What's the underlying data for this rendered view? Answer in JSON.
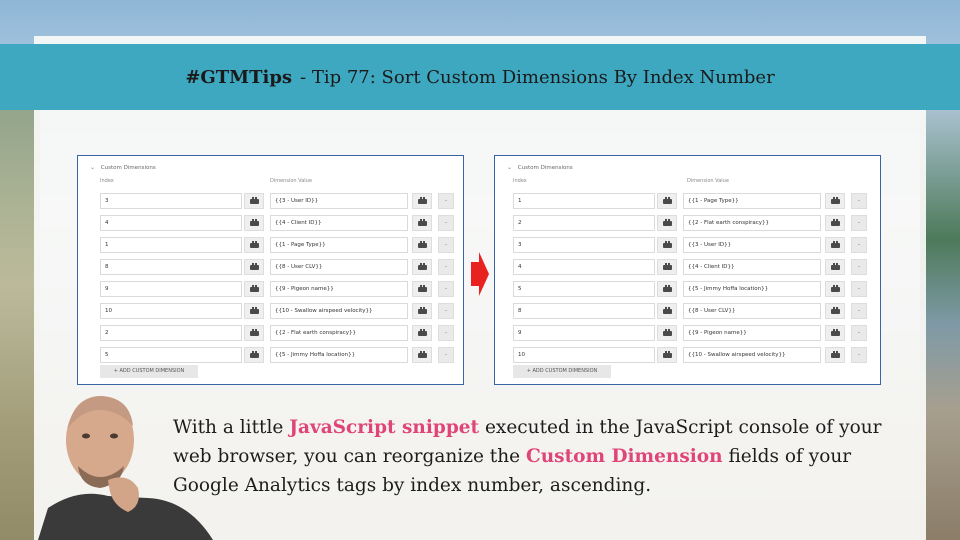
{
  "header": {
    "hashtag": "#GTMTips",
    "title": "- Tip 77: Sort Custom Dimensions By Index Number"
  },
  "before": {
    "section_title": "Custom Dimensions",
    "col_index": "Index",
    "col_value": "Dimension Value",
    "rows": [
      {
        "index": "3",
        "value": "{{3 - User ID}}"
      },
      {
        "index": "4",
        "value": "{{4 - Client ID}}"
      },
      {
        "index": "1",
        "value": "{{1 - Page Type}}"
      },
      {
        "index": "8",
        "value": "{{8 - User CLV}}"
      },
      {
        "index": "9",
        "value": "{{9 - Pigeon name}}"
      },
      {
        "index": "10",
        "value": "{{10 - Swallow airspeed velocity}}"
      },
      {
        "index": "2",
        "value": "{{2 - Flat earth conspiracy}}"
      },
      {
        "index": "5",
        "value": "{{5 - Jimmy Hoffa location}}"
      }
    ],
    "add_button": "+ ADD CUSTOM DIMENSION",
    "remove_label": "-"
  },
  "after": {
    "section_title": "Custom Dimensions",
    "col_index": "Index",
    "col_value": "Dimension Value",
    "rows": [
      {
        "index": "1",
        "value": "{{1 - Page Type}}"
      },
      {
        "index": "2",
        "value": "{{2 - Flat earth conspiracy}}"
      },
      {
        "index": "3",
        "value": "{{3 - User ID}}"
      },
      {
        "index": "4",
        "value": "{{4 - Client ID}}"
      },
      {
        "index": "5",
        "value": "{{5 - Jimmy Hoffa location}}"
      },
      {
        "index": "8",
        "value": "{{8 - User CLV}}"
      },
      {
        "index": "9",
        "value": "{{9 - Pigeon name}}"
      },
      {
        "index": "10",
        "value": "{{10 - Swallow airspeed velocity}}"
      }
    ],
    "add_button": "+ ADD CUSTOM DIMENSION",
    "remove_label": "-"
  },
  "caption": {
    "part1": "With a little ",
    "hl1": "JavaScript snippet",
    "part2": " executed in the JavaScript console of your web browser, you can reorganize the ",
    "hl2": "Custom Dimension",
    "part3": " fields of your Google Analytics tags by index number, ascending."
  },
  "colors": {
    "header_bar": "#3ea8c1",
    "highlight": "#e0457a",
    "arrow": "#e8231f",
    "screenshot_border": "#3b64a8"
  },
  "icons": {
    "variable": "lego-brick-icon",
    "arrow": "right-arrow-icon",
    "chevron": "chevron-down-icon"
  }
}
